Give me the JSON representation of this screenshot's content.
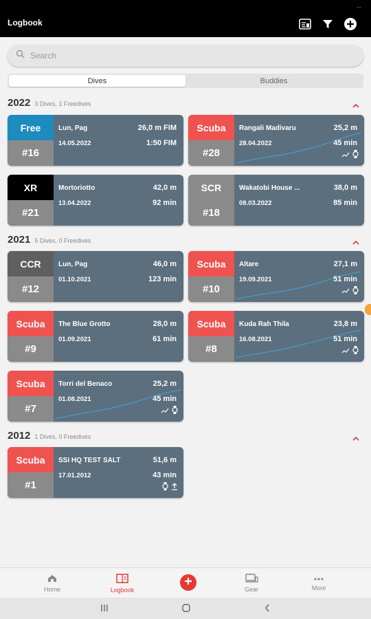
{
  "app": {
    "title": "Logbook",
    "status_icon": "..."
  },
  "search": {
    "placeholder": "Search"
  },
  "segments": [
    {
      "label": "Dives",
      "active": true
    },
    {
      "label": "Buddies",
      "active": false
    }
  ],
  "years": [
    {
      "year": "2022",
      "summary": "3 Dives, 1 Freedives",
      "dives": [
        {
          "type": "Free",
          "type_color": "#1e8bbf",
          "number": "#16",
          "site": "Lun, Pag",
          "date": "14.05.2022",
          "depth": "26,0 m FIM",
          "time": "1:50 FIM",
          "has_profile": false,
          "icons": []
        },
        {
          "type": "Scuba",
          "type_color": "#ef5350",
          "number": "#28",
          "site": "Rangali Madivaru",
          "date": "28.04.2022",
          "depth": "25,2 m",
          "time": "45 min",
          "has_profile": true,
          "icons": [
            "profile-icon",
            "watch-icon"
          ]
        },
        {
          "type": "XR",
          "type_color": "#000000",
          "number": "#21",
          "site": "Mortoriotto",
          "date": "13.04.2022",
          "depth": "42,0 m",
          "time": "92 min",
          "has_profile": false,
          "icons": []
        },
        {
          "type": "SCR",
          "type_color": "#8a8a8a",
          "number": "#18",
          "site": "Wakatobi House ...",
          "date": "08.03.2022",
          "depth": "38,0 m",
          "time": "85 min",
          "has_profile": false,
          "icons": []
        }
      ]
    },
    {
      "year": "2021",
      "summary": "5 Dives, 0 Freedives",
      "dives": [
        {
          "type": "CCR",
          "type_color": "#5f5f5f",
          "number": "#12",
          "site": "Lun, Pag",
          "date": "01.10.2021",
          "depth": "46,0 m",
          "time": "123 min",
          "has_profile": false,
          "icons": []
        },
        {
          "type": "Scuba",
          "type_color": "#ef5350",
          "number": "#10",
          "site": "Altare",
          "date": "19.09.2021",
          "depth": "27,1 m",
          "time": "51 min",
          "has_profile": true,
          "icons": [
            "profile-icon",
            "watch-icon"
          ]
        },
        {
          "type": "Scuba",
          "type_color": "#ef5350",
          "number": "#9",
          "site": "The Blue Grotto",
          "date": "01.09.2021",
          "depth": "28,0 m",
          "time": "61 min",
          "has_profile": false,
          "icons": []
        },
        {
          "type": "Scuba",
          "type_color": "#ef5350",
          "number": "#8",
          "site": "Kuda Rah Thila",
          "date": "16.08.2021",
          "depth": "23,8 m",
          "time": "51 min",
          "has_profile": true,
          "icons": [
            "profile-icon",
            "watch-icon"
          ]
        },
        {
          "type": "Scuba",
          "type_color": "#ef5350",
          "number": "#7",
          "site": "Torri del Benaco",
          "date": "01.08.2021",
          "depth": "25,2 m",
          "time": "45 min",
          "has_profile": true,
          "icons": [
            "profile-icon",
            "watch-icon"
          ]
        }
      ]
    },
    {
      "year": "2012",
      "summary": "1 Dives, 0 Freedives",
      "dives": [
        {
          "type": "Scuba",
          "type_color": "#ef5350",
          "number": "#1",
          "site": "SSI HQ TEST SALT",
          "date": "17.01.2012",
          "depth": "51,6 m",
          "time": "43 min",
          "has_profile": false,
          "icons": [
            "watch-icon",
            "upload-icon"
          ]
        }
      ]
    }
  ],
  "bottom_nav": [
    {
      "label": "Home",
      "icon": "home-icon",
      "active": false
    },
    {
      "label": "Logbook",
      "icon": "logbook-icon",
      "active": true
    },
    {
      "label": "",
      "icon": "add-icon",
      "active": false
    },
    {
      "label": "Gear",
      "icon": "gear-icon",
      "active": false
    },
    {
      "label": "More",
      "icon": "more-icon",
      "active": false
    }
  ],
  "colors": {
    "accent": "#e53935",
    "card_bg": "#5b6f7e",
    "number_bg": "#8a8a8a",
    "profile_line": "#3fa9d8"
  }
}
